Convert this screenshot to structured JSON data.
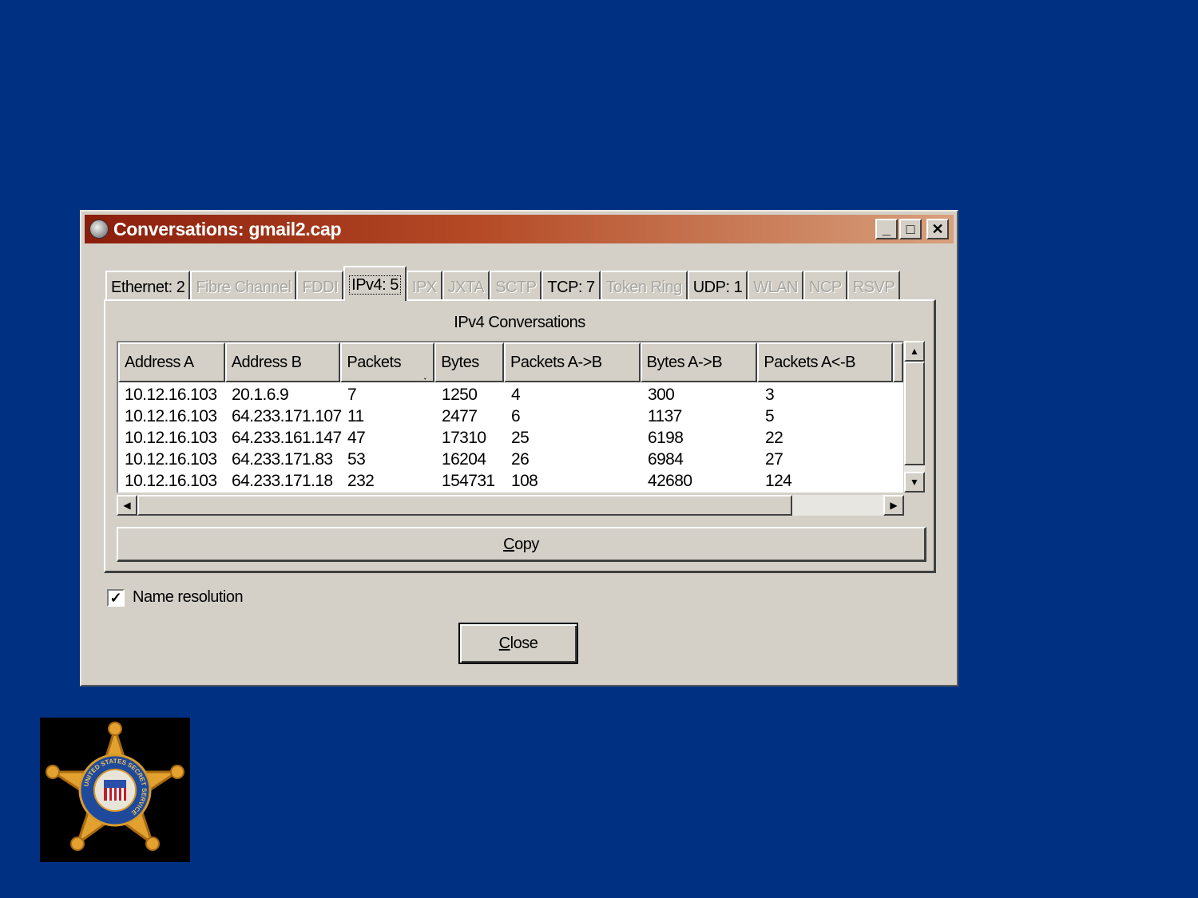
{
  "window": {
    "title": "Conversations: gmail2.cap",
    "minimize_symbol": "_",
    "maximize_symbol": "□",
    "close_symbol": "✕"
  },
  "tabs": [
    {
      "label": "Ethernet: 2",
      "enabled": true,
      "active": false
    },
    {
      "label": "Fibre Channel",
      "enabled": false,
      "active": false
    },
    {
      "label": "FDDI",
      "enabled": false,
      "active": false
    },
    {
      "label": "IPv4: 5",
      "enabled": true,
      "active": true
    },
    {
      "label": "IPX",
      "enabled": false,
      "active": false
    },
    {
      "label": "JXTA",
      "enabled": false,
      "active": false
    },
    {
      "label": "SCTP",
      "enabled": false,
      "active": false
    },
    {
      "label": "TCP: 7",
      "enabled": true,
      "active": false
    },
    {
      "label": "Token Ring",
      "enabled": false,
      "active": false
    },
    {
      "label": "UDP: 1",
      "enabled": true,
      "active": false
    },
    {
      "label": "WLAN",
      "enabled": false,
      "active": false
    },
    {
      "label": "NCP",
      "enabled": false,
      "active": false
    },
    {
      "label": "RSVP",
      "enabled": false,
      "active": false
    }
  ],
  "panel": {
    "title": "IPv4 Conversations",
    "columns": [
      "Address A",
      "Address B",
      "Packets",
      "Bytes",
      "Packets A->B",
      "Bytes A->B",
      "Packets A<-B"
    ],
    "sort_indicator": "˯",
    "rows": [
      [
        "10.12.16.103",
        "20.1.6.9",
        "7",
        "1250",
        "4",
        "300",
        "3"
      ],
      [
        "10.12.16.103",
        "64.233.171.107",
        "11",
        "2477",
        "6",
        "1137",
        "5"
      ],
      [
        "10.12.16.103",
        "64.233.161.147",
        "47",
        "17310",
        "25",
        "6198",
        "22"
      ],
      [
        "10.12.16.103",
        "64.233.171.83",
        "53",
        "16204",
        "26",
        "6984",
        "27"
      ],
      [
        "10.12.16.103",
        "64.233.171.18",
        "232",
        "154731",
        "108",
        "42680",
        "124"
      ]
    ],
    "copy_label_underlined": "C",
    "copy_label_rest": "opy"
  },
  "name_resolution": {
    "label": "Name resolution",
    "checked": true,
    "check_symbol": "✓"
  },
  "close_button": {
    "label_underlined": "C",
    "label_rest": "lose"
  },
  "logo": {
    "text": "UNITED STATES SECRET SERVICE",
    "star_color": "#e3a12f",
    "ring_color": "#1f4a9c"
  },
  "colors": {
    "background": "#003082",
    "titlebar_start": "#8a1e0c",
    "dialog": "#d4d0c8"
  }
}
